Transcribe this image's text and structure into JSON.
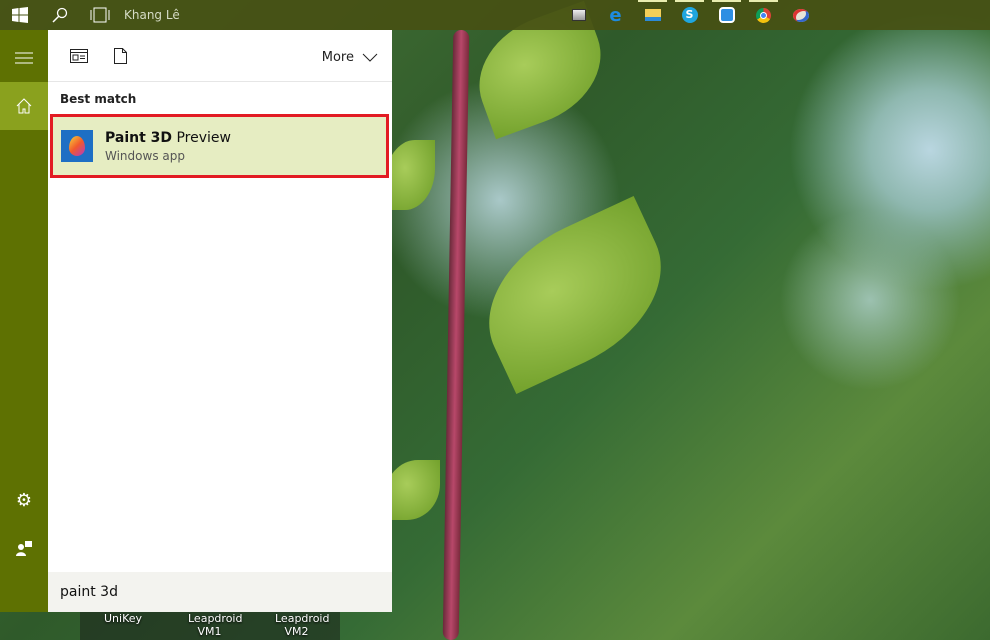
{
  "taskbar": {
    "user": "Khang Lê",
    "apps": [
      "app-window",
      "edge",
      "file-explorer",
      "skype",
      "zalo",
      "chrome",
      "paint"
    ]
  },
  "panel": {
    "more_label": "More",
    "section": "Best match",
    "result": {
      "name_bold": "Paint 3D",
      "name_rest": " Preview",
      "subtitle": "Windows app"
    },
    "search_value": "paint 3d"
  },
  "desktop": [
    "UniKey",
    "Leapdroid VM1",
    "Leapdroid VM2"
  ],
  "colors": {
    "rail": "#5e7102",
    "selected": "#8aa11e",
    "highlight": "#e6edc2",
    "border": "#e21b23"
  }
}
